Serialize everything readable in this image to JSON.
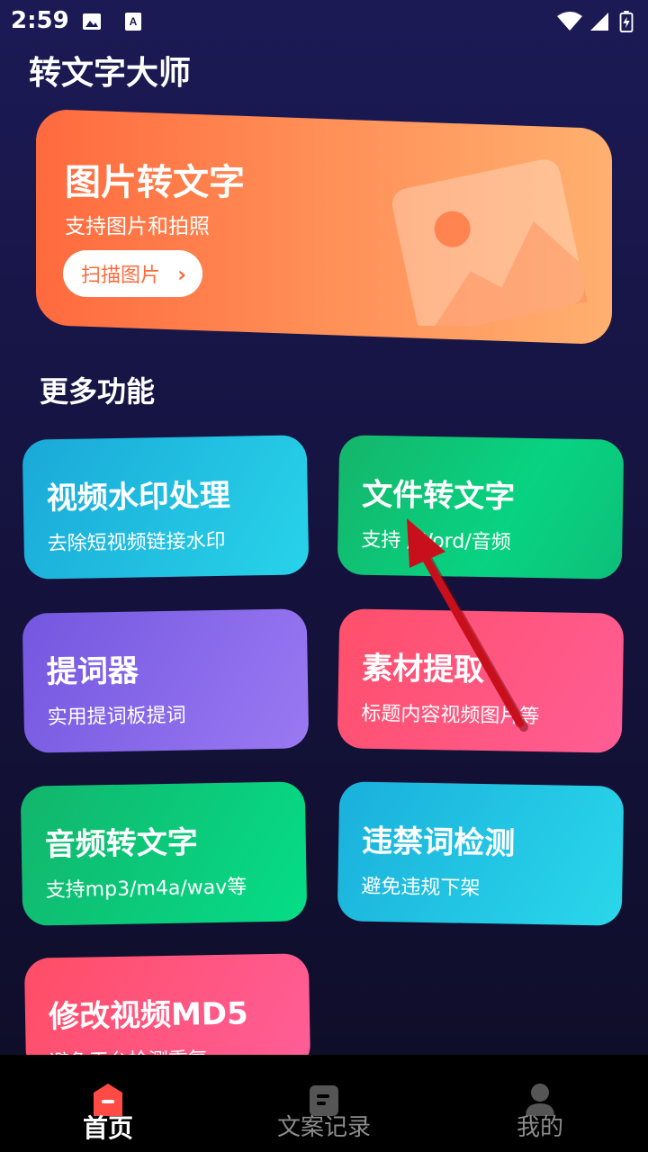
{
  "status_bar": {
    "time": "2:59",
    "icons": [
      "image-icon",
      "font-icon",
      "wifi-icon",
      "signal-icon",
      "battery-charging-icon"
    ]
  },
  "app_title": "转文字大师",
  "hero": {
    "title": "图片转文字",
    "subtitle": "支持图片和拍照",
    "button_label": "扫描图片",
    "chevron": "›",
    "colors": {
      "start": "#ff6a3d",
      "end": "#ffb070"
    }
  },
  "section_title": "更多功能",
  "features": [
    {
      "title": "视频水印处理",
      "subtitle": "去除短视频链接水印"
    },
    {
      "title": "文件转文字",
      "subtitle": "支持 /Word/音频"
    },
    {
      "title": "提词器",
      "subtitle": "实用提词板提词"
    },
    {
      "title": "素材提取",
      "subtitle": "标题内容视频图片等"
    },
    {
      "title": "音频转文字",
      "subtitle": "支持mp3/m4a/wav等"
    },
    {
      "title": "违禁词检测",
      "subtitle": "避免违规下架"
    },
    {
      "title": "修改视频MD5",
      "subtitle": "避免平台检测重复"
    }
  ],
  "bottom_nav": [
    {
      "label": "首页",
      "icon": "home-icon",
      "active": true
    },
    {
      "label": "文案记录",
      "icon": "document-icon",
      "active": false
    },
    {
      "label": "我的",
      "icon": "user-icon",
      "active": false
    }
  ],
  "annotation": {
    "icon": "red-arrow-icon",
    "color": "#c8101c"
  }
}
